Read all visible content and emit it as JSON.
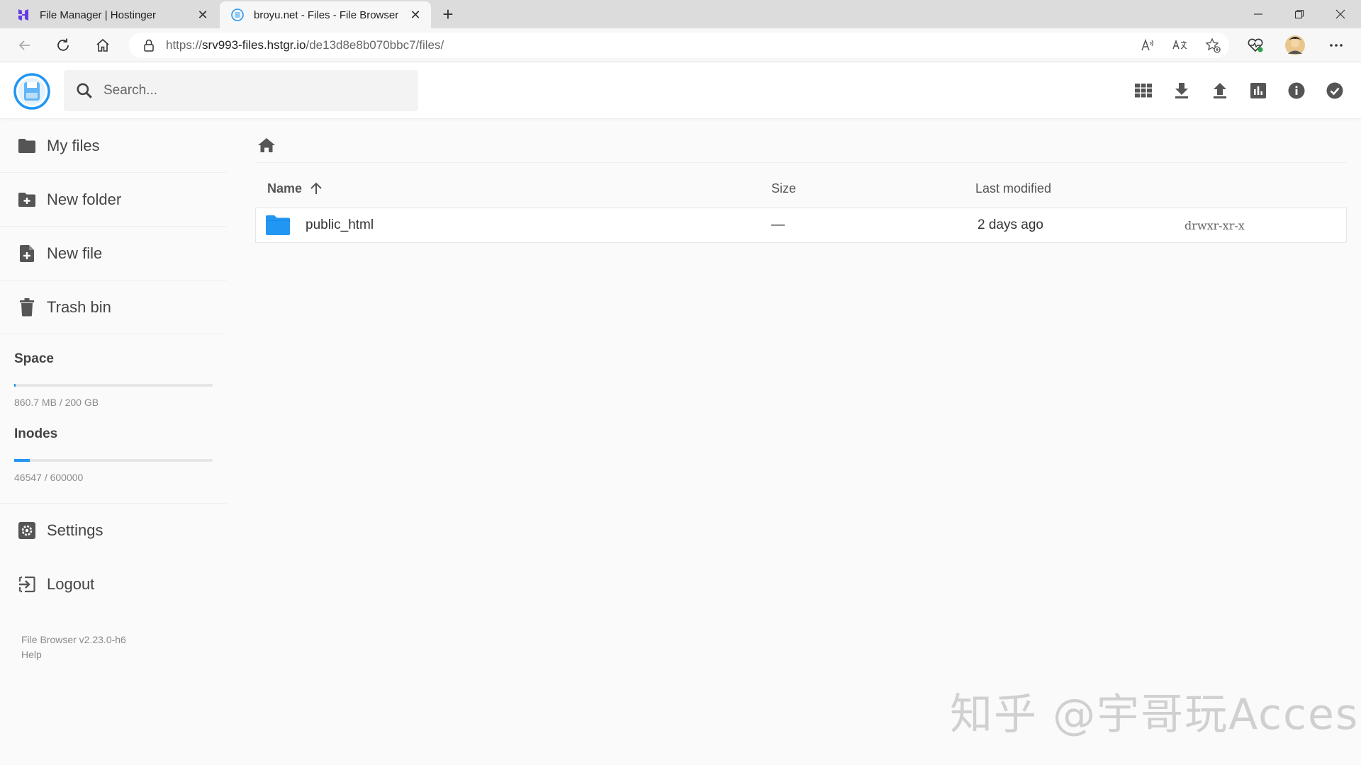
{
  "browser": {
    "tabs": [
      {
        "title": "File Manager | Hostinger",
        "active": false
      },
      {
        "title": "broyu.net - Files - File Browser",
        "active": true
      }
    ],
    "url_prefix": "https://",
    "url_host": "srv993-files.hstgr.io",
    "url_path": "/de13d8e8b070bbc7/files/"
  },
  "header": {
    "search_placeholder": "Search...",
    "icons": [
      "grid-view-icon",
      "download-icon",
      "upload-icon",
      "chart-icon",
      "info-icon",
      "check-circle-icon"
    ]
  },
  "sidebar": {
    "items": [
      {
        "label": "My files",
        "icon": "folder-icon"
      },
      {
        "label": "New folder",
        "icon": "folder-plus-icon"
      },
      {
        "label": "New file",
        "icon": "file-plus-icon"
      },
      {
        "label": "Trash bin",
        "icon": "trash-icon"
      }
    ],
    "space": {
      "label": "Space",
      "value": "860.7 MB / 200 GB",
      "fraction": 0.004
    },
    "inodes": {
      "label": "Inodes",
      "value": "46547 / 600000",
      "fraction": 0.078
    },
    "settings_label": "Settings",
    "logout_label": "Logout",
    "version": "File Browser v2.23.0-h6",
    "help": "Help"
  },
  "listing": {
    "columns": {
      "name": "Name",
      "size": "Size",
      "modified": "Last modified"
    },
    "rows": [
      {
        "name": "public_html",
        "size": "—",
        "modified": "2 days ago",
        "permissions": "drwxr-xr-x"
      }
    ]
  },
  "colors": {
    "accent": "#2196f3",
    "folder": "#2196f3"
  },
  "watermark": "知乎 @宇哥玩Access"
}
